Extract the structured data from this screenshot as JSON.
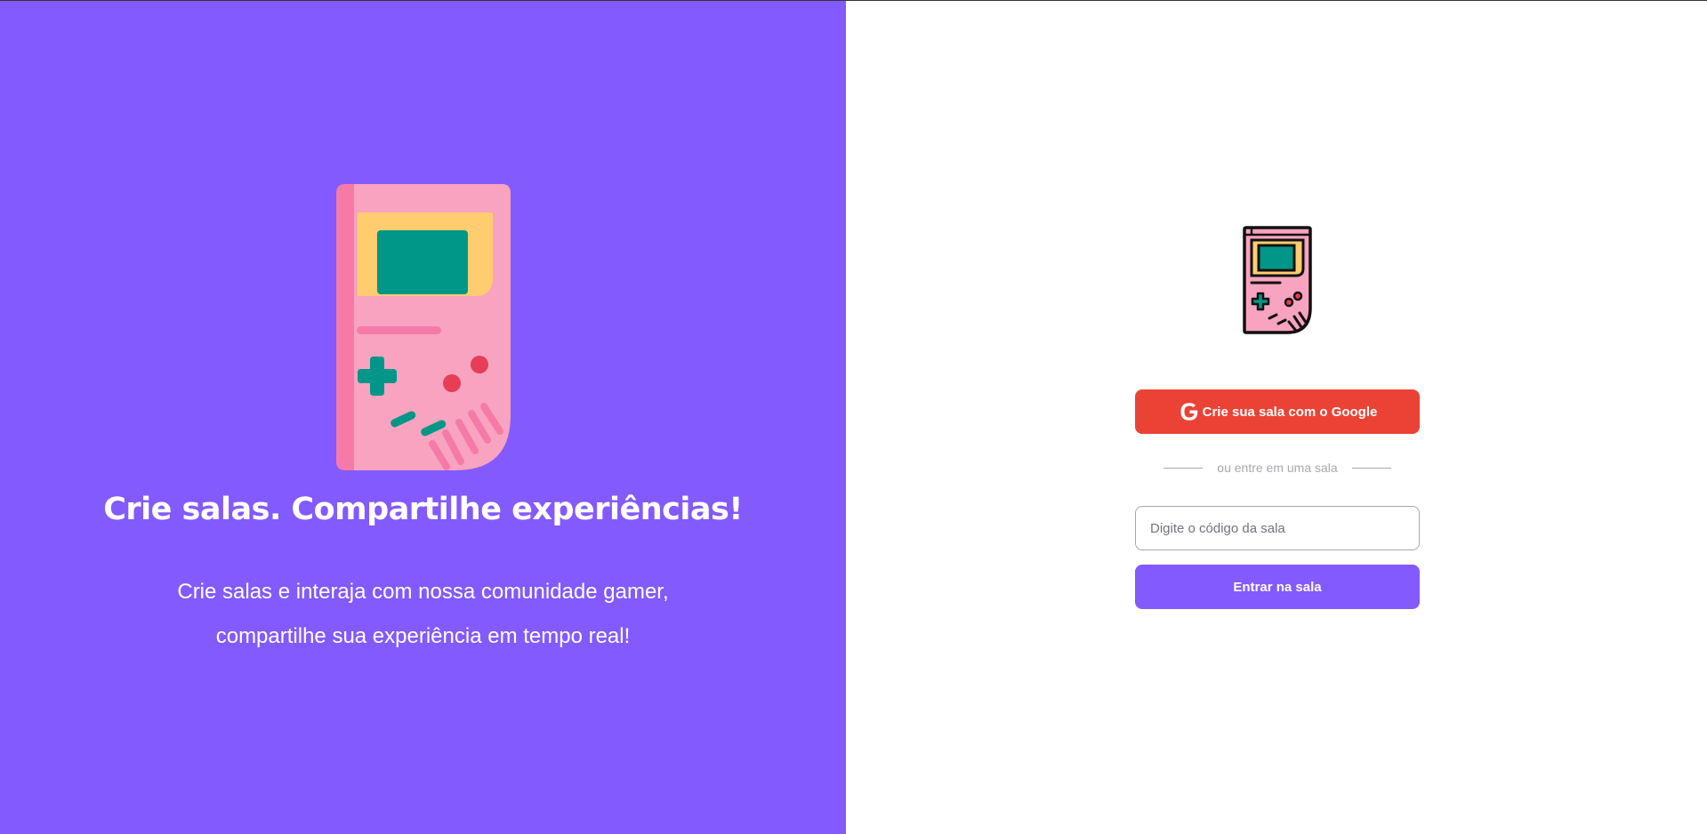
{
  "aside": {
    "title": "Crie salas. Compartilhe experiências!",
    "subtitle_line1": "Crie salas e interaja com nossa comunidade gamer,",
    "subtitle_line2": "compartilhe sua experiência em tempo real!",
    "illustration_icon": "gameboy-illustration",
    "background_color": "#835afd"
  },
  "main": {
    "logo_icon": "gameboy-logo-icon",
    "google_button": {
      "label": "Crie sua sala com o Google",
      "icon": "google-icon",
      "color": "#ea4335"
    },
    "separator_text": "ou entre em uma sala",
    "room_input": {
      "placeholder": "Digite o código da sala",
      "value": ""
    },
    "enter_button": {
      "label": "Entrar na sala",
      "color": "#835afd"
    }
  }
}
